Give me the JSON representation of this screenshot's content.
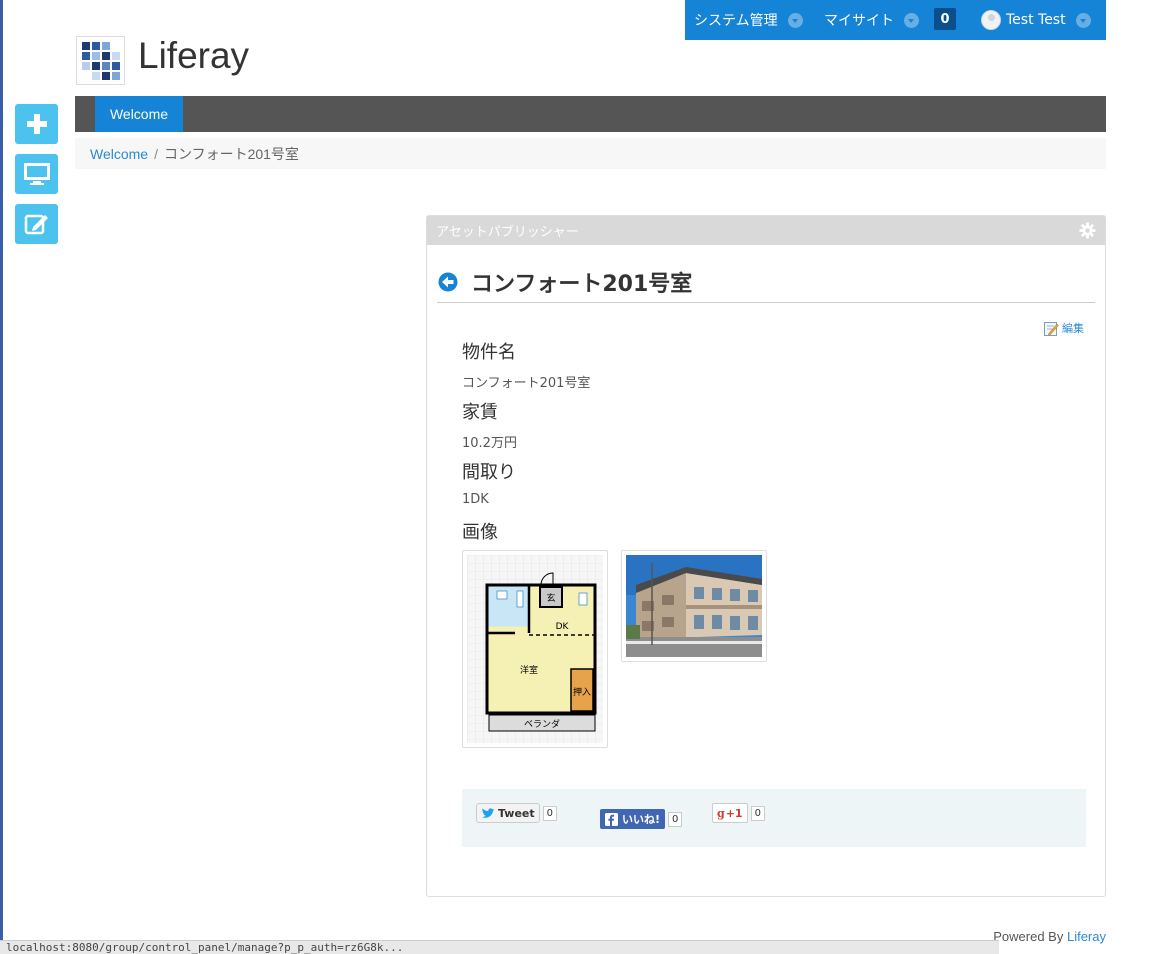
{
  "dockbar": {
    "system_admin": "システム管理",
    "my_sites": "マイサイト",
    "notification_count": "0",
    "user_name": "Test Test"
  },
  "site": {
    "name": "Liferay"
  },
  "nav": {
    "tabs": [
      {
        "label": "Welcome"
      }
    ]
  },
  "breadcrumb": {
    "home": "Welcome",
    "separator": "/",
    "current": "コンフォート201号室"
  },
  "portlet": {
    "title": "アセットパブリッシャー",
    "asset_title": "コンフォート201号室",
    "edit_label": "編集",
    "fields": [
      {
        "label": "物件名",
        "value": "コンフォート201号室"
      },
      {
        "label": "家賃",
        "value": "10.2万円"
      },
      {
        "label": "間取り",
        "value": "1DK"
      },
      {
        "label": "画像",
        "value": ""
      }
    ],
    "floorplan": {
      "entrance": "玄",
      "dk": "DK",
      "western_room": "洋室",
      "closet": "押入",
      "veranda": "ベランダ"
    },
    "social": {
      "tweet_label": "Tweet",
      "tweet_count": "0",
      "like_label": "いいね!",
      "like_count": "0",
      "gplus_label": "+1",
      "gplus_count": "0"
    }
  },
  "footer": {
    "powered_by": "Powered By",
    "powered_link": "Liferay"
  },
  "statusbar": {
    "url": "localhost:8080/group/control_panel/manage?p_p_auth=rz6G8k..."
  },
  "colors": {
    "accent": "#1583d6",
    "control": "#4bc3ee",
    "nav": "#555555"
  }
}
